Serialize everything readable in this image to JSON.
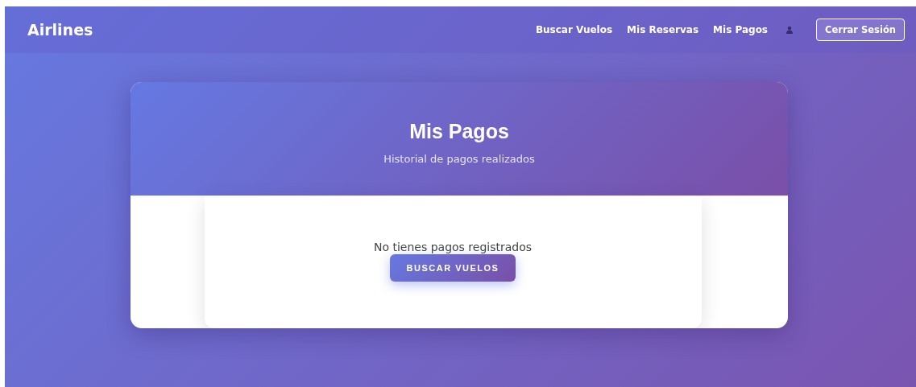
{
  "navbar": {
    "brand": "Airlines",
    "links": [
      {
        "label": "Buscar Vuelos",
        "selected": false
      },
      {
        "label": "Mis Reservas",
        "selected": false
      },
      {
        "label": "Mis Pagos",
        "selected": false
      }
    ],
    "logout": "Cerrar Sesión"
  },
  "page": {
    "title": "Mis Pagos",
    "subtitle": "Historial de pagos realizados",
    "empty_message": "No tienes pagos registrados",
    "action": "BUSCAR VUELOS"
  }
}
